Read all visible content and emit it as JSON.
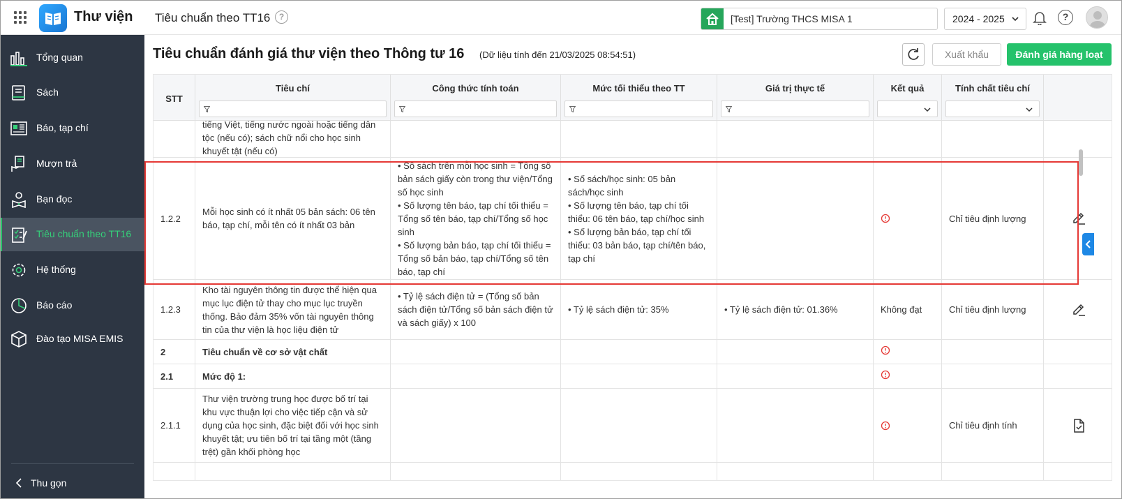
{
  "app": {
    "name": "Thư viện",
    "page_head": "Tiêu chuẩn theo TT16",
    "school": "[Test] Trường THCS MISA 1",
    "year": "2024 - 2025"
  },
  "sidebar": {
    "items": [
      {
        "label": "Tổng quan",
        "icon": "chart-bar-icon"
      },
      {
        "label": "Sách",
        "icon": "book-icon"
      },
      {
        "label": "Báo, tạp chí",
        "icon": "newspaper-icon"
      },
      {
        "label": "Mượn trả",
        "icon": "hand-book-icon"
      },
      {
        "label": "Bạn đọc",
        "icon": "reader-icon"
      },
      {
        "label": "Tiêu chuẩn theo TT16",
        "icon": "checklist-icon",
        "active": true
      },
      {
        "label": "Hệ thống",
        "icon": "gear-icon"
      },
      {
        "label": "Báo cáo",
        "icon": "pie-chart-icon"
      },
      {
        "label": "Đào tạo MISA EMIS",
        "icon": "cube-icon"
      }
    ],
    "collapse_label": "Thu gọn",
    "active_color": "#35d07a"
  },
  "main": {
    "title": "Tiêu chuẩn đánh giá thư viện theo Thông tư 16",
    "subtitle": "(Dữ liệu tính đến 21/03/2025 08:54:51)",
    "export_label": "Xuất khẩu",
    "eval_label": "Đánh giá hàng loạt",
    "accent": "#25c26b"
  },
  "table": {
    "columns": [
      "STT",
      "Tiêu chí",
      "Công thức tính toán",
      "Mức tối thiểu theo TT",
      "Giá trị thực tế",
      "Kết quả",
      "Tính chất tiêu chí"
    ],
    "rows": [
      {
        "stt": "",
        "criteria": "tiếng Việt, tiếng nước ngoài hoặc tiếng dân tộc (nếu có); sách chữ nổi cho học sinh khuyết tật (nếu có)",
        "formula": "",
        "minimum": "",
        "actual": "",
        "result": "",
        "nature": "",
        "action": ""
      },
      {
        "stt": "1.2.2",
        "criteria": "Mỗi học sinh có ít nhất 05 bản sách: 06 tên báo, tạp chí, mỗi tên có ít nhất 03 bản",
        "formula": "• Số sách trên mỗi học sinh = Tổng số bản sách giấy còn trong thư viện/Tổng số học sinh\n• Số lượng tên báo, tạp chí tối thiểu = Tổng số tên báo, tạp chí/Tổng số học sinh\n• Số lượng bản báo, tạp chí tối thiểu = Tổng số bản báo, tạp chí/Tổng số tên báo, tạp chí",
        "minimum": "• Số sách/học sinh: 05 bản sách/học sinh\n• Số lượng tên báo, tạp chí tối thiểu: 06 tên báo, tạp chí/học sinh\n• Số lượng bản báo, tạp chí tối thiểu: 03 bản báo, tạp chí/tên báo, tạp chí",
        "actual": "",
        "result": "",
        "result_icon": "warning-icon",
        "nature": "Chỉ tiêu định lượng",
        "action": "edit-icon"
      },
      {
        "stt": "1.2.3",
        "criteria": "Kho tài nguyên thông tin được thể hiện qua mục lục điện tử thay cho mục lục truyền thống. Bảo đảm 35% vốn tài nguyên thông tin của thư viện là học liệu điện tử",
        "formula": "• Tỷ lệ sách điện tử = (Tổng số bản sách điện tử/Tổng số bản sách điện tử và sách giấy) x 100",
        "minimum": "• Tỷ lệ sách điện tử: 35%",
        "actual": "• Tỷ lệ sách điện tử: 01.36%",
        "result": "Không đạt",
        "nature": "Chỉ tiêu định lượng",
        "action": "edit-icon"
      },
      {
        "stt": "2",
        "criteria": "Tiêu chuẩn về cơ sở vật chất",
        "bold": true,
        "formula": "",
        "minimum": "",
        "actual": "",
        "result": "",
        "result_icon": "warning-icon",
        "nature": "",
        "action": ""
      },
      {
        "stt": "2.1",
        "criteria": "Mức độ 1:",
        "bold": true,
        "formula": "",
        "minimum": "",
        "actual": "",
        "result": "",
        "result_icon": "warning-icon",
        "nature": "",
        "action": ""
      },
      {
        "stt": "2.1.1",
        "criteria": "Thư viện trường trung học được bố trí tại khu vực thuận lợi cho việc tiếp cận và sử dụng của học sinh, đặc biệt đối với học sinh khuyết tật; ưu tiên bố trí tại tầng một (tầng trệt) gần khối phòng học",
        "formula": "",
        "minimum": "",
        "actual": "",
        "result": "",
        "result_icon": "warning-icon",
        "nature": "Chỉ tiêu định tính",
        "action": "document-check-icon"
      }
    ]
  }
}
